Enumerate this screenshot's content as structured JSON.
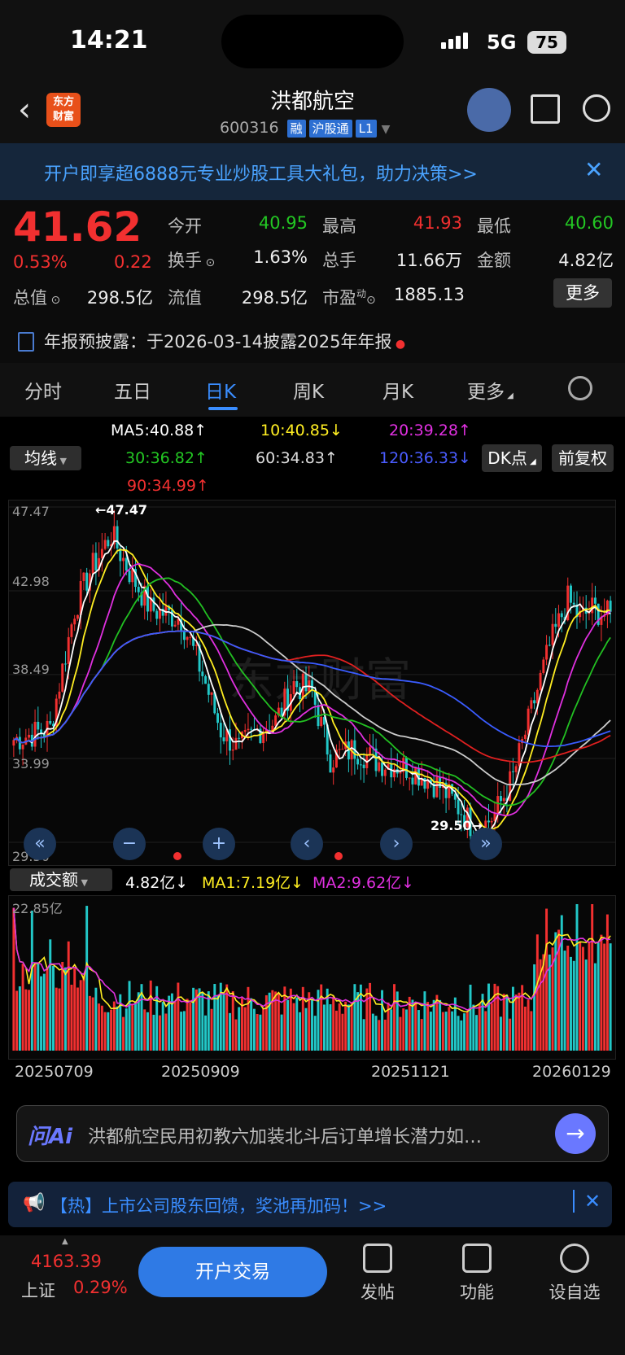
{
  "status": {
    "time": "14:21",
    "network": "5G",
    "battery": "75"
  },
  "header": {
    "title": "洪都航空",
    "code": "600316",
    "tags": [
      "融",
      "沪股通",
      "L1"
    ]
  },
  "banner": {
    "text": "开户即享超6888元专业炒股工具大礼包，助力决策>>",
    "close": "✕"
  },
  "quote": {
    "price": "41.62",
    "pct": "0.53%",
    "change": "0.22",
    "open_label": "今开",
    "open": "40.95",
    "high_label": "最高",
    "high": "41.93",
    "low_label": "最低",
    "low": "40.60",
    "turnover_label": "换手",
    "turnover": "1.63%",
    "volume_label": "总手",
    "volume": "11.66万",
    "amount_label": "金额",
    "amount": "4.82亿",
    "mktcap_label": "总值",
    "mktcap": "298.5亿",
    "float_label": "流值",
    "float": "298.5亿",
    "pe_label": "市盈",
    "pe_sup": "动",
    "pe": "1885.13",
    "more": "更多"
  },
  "notice": {
    "text": "年报预披露：于2026-03-14披露2025年年报"
  },
  "tabs": [
    {
      "label": "分时"
    },
    {
      "label": "五日"
    },
    {
      "label": "日K"
    },
    {
      "label": "周K"
    },
    {
      "label": "月K"
    },
    {
      "label": "更多"
    }
  ],
  "ma": {
    "selector": "均线",
    "ma5": "MA5:40.88↑",
    "ma10": "10:40.85↓",
    "ma20": "20:39.28↑",
    "ma30": "30:36.82↑",
    "ma60": "60:34.83↑",
    "ma120": "120:36.33↓",
    "ma90": "90:34.99↑",
    "dk": "DK点",
    "adjust": "前复权"
  },
  "kline": {
    "ylabels": [
      "47.47",
      "42.98",
      "38.49",
      "33.99",
      "29.50"
    ],
    "max_label": "←47.47",
    "min_label": "29.50→",
    "watermark": "东方财富",
    "colors": {
      "up": "#f23030",
      "down": "#22c8c8",
      "ma5": "#ffffff",
      "ma10": "#ffee22",
      "ma20": "#e030e0",
      "ma30": "#22c022",
      "ma60": "#cccccc",
      "ma90": "#e02020",
      "ma120": "#3a5cff"
    }
  },
  "volume": {
    "selector": "成交额",
    "current": "4.82亿↓",
    "ma1": "MA1:7.19亿↓",
    "ma2": "MA2:9.62亿↓",
    "max": "22.85亿",
    "dates": [
      "20250709",
      "20250909",
      "20251121",
      "20260129"
    ]
  },
  "ai": {
    "logo": "问Ai",
    "text": "洪都航空民用初教六加装北斗后订单增长潜力如…"
  },
  "hot": {
    "text": "【热】上市公司股东回馈，奖池再加码！>>"
  },
  "bottom": {
    "index_value": "4163.39",
    "index_name": "上证",
    "index_pct": "0.29%",
    "trade": "开户交易",
    "post": "发帖",
    "func": "功能",
    "watch": "设自选"
  }
}
